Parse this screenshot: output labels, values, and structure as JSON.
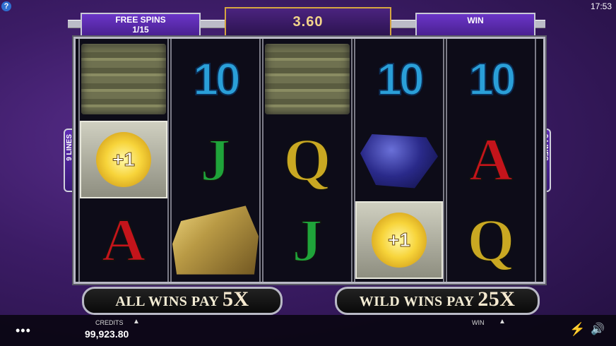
{
  "header": {
    "free_spins_label": "FREE SPINS",
    "free_spins_count": "1/15",
    "balance": "3.60",
    "win_label": "WIN"
  },
  "clock": "17:53",
  "lines_label": "9 LINES",
  "reels": [
    [
      "money-stack",
      "vault-plus1",
      "A"
    ],
    [
      "10",
      "J",
      "gold-bars"
    ],
    [
      "money-stack",
      "Q",
      "J"
    ],
    [
      "10",
      "diamond",
      "vault-plus1"
    ],
    [
      "10",
      "A",
      "Q"
    ]
  ],
  "vault_text": "+1",
  "banners": {
    "left_text": "ALL WINS PAY",
    "left_mult": "5X",
    "right_text": "WILD WINS PAY",
    "right_mult": "25X"
  },
  "footer": {
    "credits_label": "CREDITS",
    "credits_value": "99,923.80",
    "win_label": "WIN"
  },
  "icons": {
    "help": "help-icon",
    "menu": "menu-dots-icon",
    "turbo": "lightning-icon",
    "sound": "speaker-icon"
  }
}
